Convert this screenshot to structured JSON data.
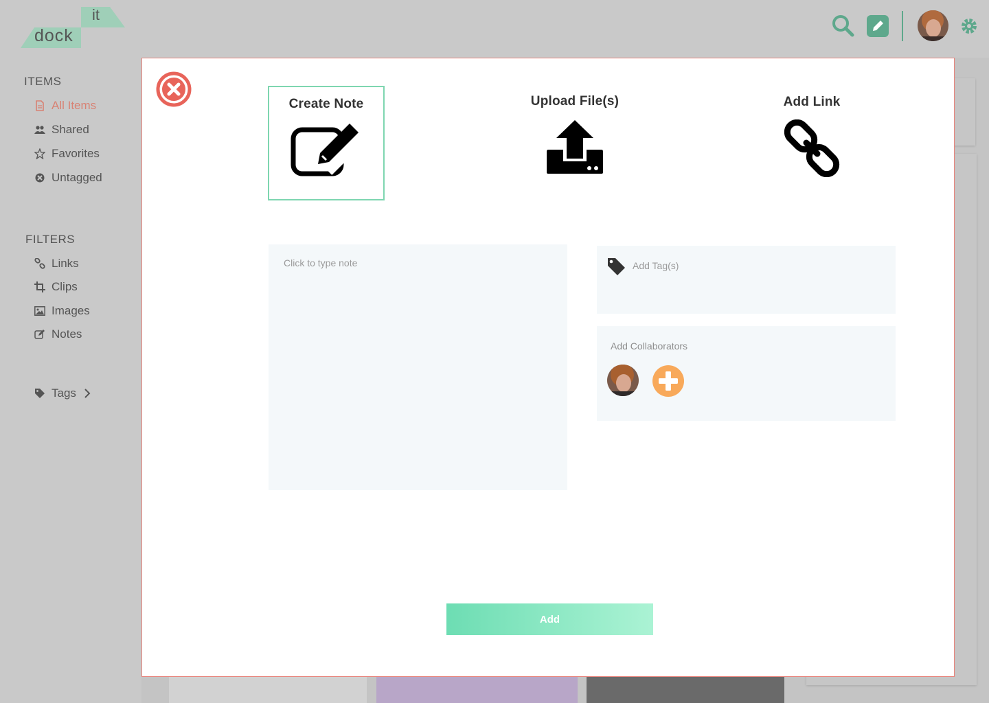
{
  "app": {
    "logo_dock": "dock",
    "logo_it": "it"
  },
  "sidebar": {
    "items_title": "ITEMS",
    "items": [
      {
        "label": "All Items",
        "icon": "file-icon",
        "active": true
      },
      {
        "label": "Shared",
        "icon": "users-icon"
      },
      {
        "label": "Favorites",
        "icon": "star-icon"
      },
      {
        "label": "Untagged",
        "icon": "untagged-icon"
      }
    ],
    "filters_title": "FILTERS",
    "filters": [
      {
        "label": "Links",
        "icon": "link-icon"
      },
      {
        "label": "Clips",
        "icon": "crop-icon"
      },
      {
        "label": "Images",
        "icon": "image-icon"
      },
      {
        "label": "Notes",
        "icon": "edit-icon"
      }
    ],
    "tags_label": "Tags"
  },
  "modal": {
    "options": [
      {
        "label": "Create Note",
        "icon": "edit-note-icon",
        "selected": true
      },
      {
        "label": "Upload File(s)",
        "icon": "upload-icon",
        "selected": false
      },
      {
        "label": "Add Link",
        "icon": "chain-link-icon",
        "selected": false
      }
    ],
    "note_placeholder": "Click to type note",
    "tag_placeholder": "Add Tag(s)",
    "collaborators_title": "Add Collaborators",
    "add_button": "Add"
  },
  "colors": {
    "accent_green": "#5ea88c",
    "selected_border": "#7ed6b0",
    "close_red": "#e8645a",
    "plus_orange": "#f8a95a",
    "active_nav": "#d88274"
  }
}
